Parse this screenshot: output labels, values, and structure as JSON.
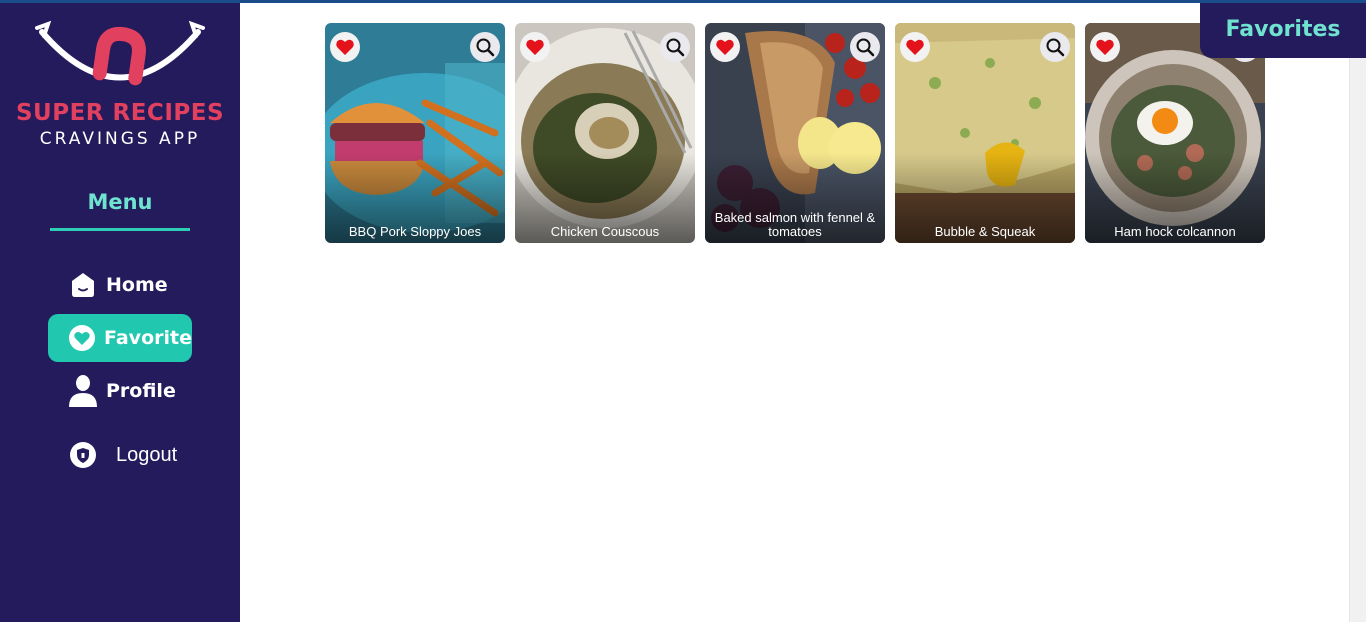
{
  "brand": {
    "title": "SUPER RECIPES",
    "subtitle": "CRAVINGS APP",
    "accent_color": "#e2405f"
  },
  "sidebar": {
    "background": "#241b5c",
    "menu_heading": "Menu",
    "items": [
      {
        "label": "Home",
        "icon": "home-icon",
        "active": false
      },
      {
        "label": "Favorites",
        "icon": "heart-icon",
        "active": true
      },
      {
        "label": "Profile",
        "icon": "user-icon",
        "active": false
      },
      {
        "label": "Logout",
        "icon": "shield-icon",
        "active": false
      }
    ],
    "active_color": "#21c7ae"
  },
  "header": {
    "section_title": "Favorites"
  },
  "recipes": [
    {
      "name": "BBQ Pork Sloppy Joes",
      "favorited": true
    },
    {
      "name": "Chicken Couscous",
      "favorited": true
    },
    {
      "name": "Baked salmon with fennel & tomatoes",
      "favorited": true
    },
    {
      "name": "Bubble & Squeak",
      "favorited": true
    },
    {
      "name": "Ham hock colcannon",
      "favorited": true
    }
  ],
  "icons": {
    "favorite": "heart-icon",
    "view": "zoom-icon"
  },
  "colors": {
    "heart": "#e3121b",
    "teal": "#6fe3cf"
  }
}
